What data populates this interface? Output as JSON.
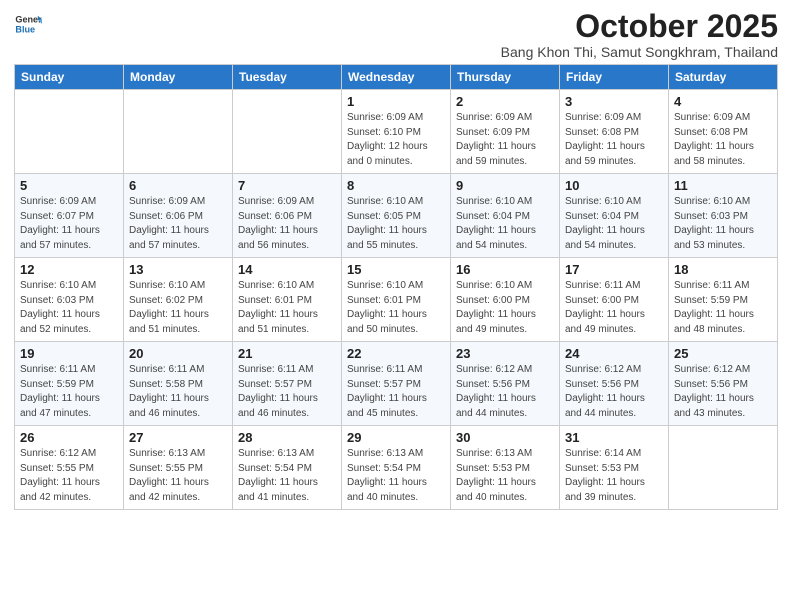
{
  "logo": {
    "line1": "General",
    "line2": "Blue"
  },
  "title": "October 2025",
  "subtitle": "Bang Khon Thi, Samut Songkhram, Thailand",
  "days_of_week": [
    "Sunday",
    "Monday",
    "Tuesday",
    "Wednesday",
    "Thursday",
    "Friday",
    "Saturday"
  ],
  "weeks": [
    [
      {
        "day": "",
        "info": ""
      },
      {
        "day": "",
        "info": ""
      },
      {
        "day": "",
        "info": ""
      },
      {
        "day": "1",
        "info": "Sunrise: 6:09 AM\nSunset: 6:10 PM\nDaylight: 12 hours\nand 0 minutes."
      },
      {
        "day": "2",
        "info": "Sunrise: 6:09 AM\nSunset: 6:09 PM\nDaylight: 11 hours\nand 59 minutes."
      },
      {
        "day": "3",
        "info": "Sunrise: 6:09 AM\nSunset: 6:08 PM\nDaylight: 11 hours\nand 59 minutes."
      },
      {
        "day": "4",
        "info": "Sunrise: 6:09 AM\nSunset: 6:08 PM\nDaylight: 11 hours\nand 58 minutes."
      }
    ],
    [
      {
        "day": "5",
        "info": "Sunrise: 6:09 AM\nSunset: 6:07 PM\nDaylight: 11 hours\nand 57 minutes."
      },
      {
        "day": "6",
        "info": "Sunrise: 6:09 AM\nSunset: 6:06 PM\nDaylight: 11 hours\nand 57 minutes."
      },
      {
        "day": "7",
        "info": "Sunrise: 6:09 AM\nSunset: 6:06 PM\nDaylight: 11 hours\nand 56 minutes."
      },
      {
        "day": "8",
        "info": "Sunrise: 6:10 AM\nSunset: 6:05 PM\nDaylight: 11 hours\nand 55 minutes."
      },
      {
        "day": "9",
        "info": "Sunrise: 6:10 AM\nSunset: 6:04 PM\nDaylight: 11 hours\nand 54 minutes."
      },
      {
        "day": "10",
        "info": "Sunrise: 6:10 AM\nSunset: 6:04 PM\nDaylight: 11 hours\nand 54 minutes."
      },
      {
        "day": "11",
        "info": "Sunrise: 6:10 AM\nSunset: 6:03 PM\nDaylight: 11 hours\nand 53 minutes."
      }
    ],
    [
      {
        "day": "12",
        "info": "Sunrise: 6:10 AM\nSunset: 6:03 PM\nDaylight: 11 hours\nand 52 minutes."
      },
      {
        "day": "13",
        "info": "Sunrise: 6:10 AM\nSunset: 6:02 PM\nDaylight: 11 hours\nand 51 minutes."
      },
      {
        "day": "14",
        "info": "Sunrise: 6:10 AM\nSunset: 6:01 PM\nDaylight: 11 hours\nand 51 minutes."
      },
      {
        "day": "15",
        "info": "Sunrise: 6:10 AM\nSunset: 6:01 PM\nDaylight: 11 hours\nand 50 minutes."
      },
      {
        "day": "16",
        "info": "Sunrise: 6:10 AM\nSunset: 6:00 PM\nDaylight: 11 hours\nand 49 minutes."
      },
      {
        "day": "17",
        "info": "Sunrise: 6:11 AM\nSunset: 6:00 PM\nDaylight: 11 hours\nand 49 minutes."
      },
      {
        "day": "18",
        "info": "Sunrise: 6:11 AM\nSunset: 5:59 PM\nDaylight: 11 hours\nand 48 minutes."
      }
    ],
    [
      {
        "day": "19",
        "info": "Sunrise: 6:11 AM\nSunset: 5:59 PM\nDaylight: 11 hours\nand 47 minutes."
      },
      {
        "day": "20",
        "info": "Sunrise: 6:11 AM\nSunset: 5:58 PM\nDaylight: 11 hours\nand 46 minutes."
      },
      {
        "day": "21",
        "info": "Sunrise: 6:11 AM\nSunset: 5:57 PM\nDaylight: 11 hours\nand 46 minutes."
      },
      {
        "day": "22",
        "info": "Sunrise: 6:11 AM\nSunset: 5:57 PM\nDaylight: 11 hours\nand 45 minutes."
      },
      {
        "day": "23",
        "info": "Sunrise: 6:12 AM\nSunset: 5:56 PM\nDaylight: 11 hours\nand 44 minutes."
      },
      {
        "day": "24",
        "info": "Sunrise: 6:12 AM\nSunset: 5:56 PM\nDaylight: 11 hours\nand 44 minutes."
      },
      {
        "day": "25",
        "info": "Sunrise: 6:12 AM\nSunset: 5:56 PM\nDaylight: 11 hours\nand 43 minutes."
      }
    ],
    [
      {
        "day": "26",
        "info": "Sunrise: 6:12 AM\nSunset: 5:55 PM\nDaylight: 11 hours\nand 42 minutes."
      },
      {
        "day": "27",
        "info": "Sunrise: 6:13 AM\nSunset: 5:55 PM\nDaylight: 11 hours\nand 42 minutes."
      },
      {
        "day": "28",
        "info": "Sunrise: 6:13 AM\nSunset: 5:54 PM\nDaylight: 11 hours\nand 41 minutes."
      },
      {
        "day": "29",
        "info": "Sunrise: 6:13 AM\nSunset: 5:54 PM\nDaylight: 11 hours\nand 40 minutes."
      },
      {
        "day": "30",
        "info": "Sunrise: 6:13 AM\nSunset: 5:53 PM\nDaylight: 11 hours\nand 40 minutes."
      },
      {
        "day": "31",
        "info": "Sunrise: 6:14 AM\nSunset: 5:53 PM\nDaylight: 11 hours\nand 39 minutes."
      },
      {
        "day": "",
        "info": ""
      }
    ]
  ]
}
